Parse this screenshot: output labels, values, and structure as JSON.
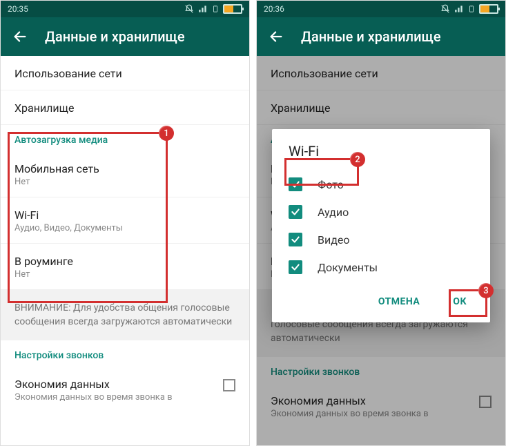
{
  "left": {
    "status_time": "20:35",
    "header_title": "Данные и хранилище",
    "rows": {
      "network_usage": "Использование сети",
      "storage": "Хранилище"
    },
    "autodownload": {
      "section": "Автозагрузка медиа",
      "mobile": {
        "title": "Мобильная сеть",
        "sub": "Нет"
      },
      "wifi": {
        "title": "Wi-Fi",
        "sub": "Аудио, Видео, Документы"
      },
      "roaming": {
        "title": "В роуминге",
        "sub": "Нет"
      }
    },
    "notice": "ВНИМАНИЕ: Для удобства общения голосовые сообщения всегда загружаются автоматически",
    "call_settings_section": "Настройки звонков",
    "low_data": {
      "title": "Экономия данных",
      "sub": "Экономия данных во время звонка в"
    },
    "callout1_badge": "1"
  },
  "right": {
    "status_time": "20:36",
    "header_title": "Данные и хранилище",
    "dialog": {
      "title": "Wi-Fi",
      "options": {
        "photo": "Фото",
        "audio": "Аудио",
        "video": "Видео",
        "docs": "Документы"
      },
      "cancel": "ОТМЕНА",
      "ok": "ОК"
    },
    "notice_tail": "голосовые сообщения всегда загружаются автоматически",
    "call_settings_section": "Настройки звонков",
    "callout2_badge": "2",
    "callout3_badge": "3"
  }
}
